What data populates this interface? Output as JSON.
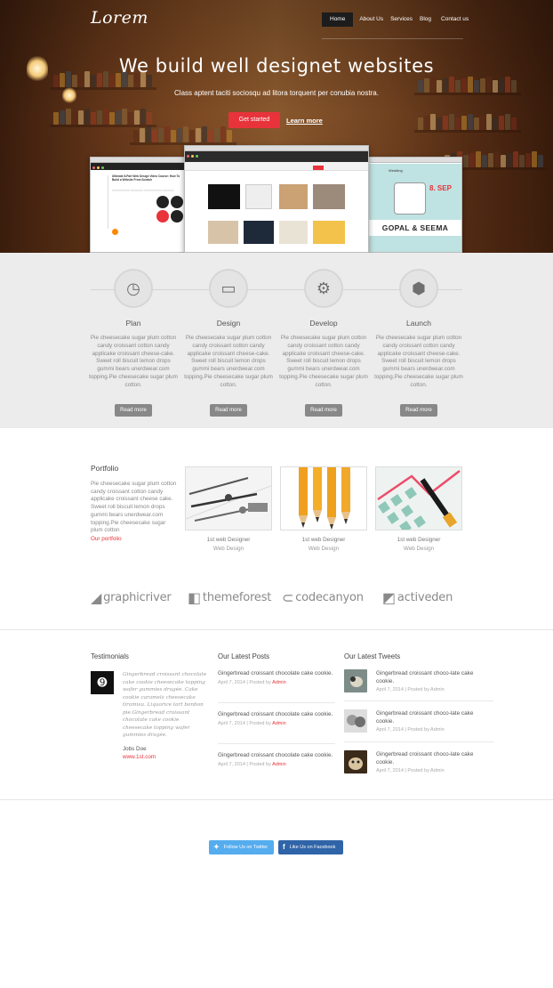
{
  "header": {
    "logo": "Lorem",
    "nav": [
      "Home",
      "About Us",
      "Services",
      "Blog",
      "Contact us"
    ]
  },
  "hero": {
    "title": "We build well designet websites",
    "subtitle": "Class aptent taciti sociosqu ad litora torquent per conubia nostra.",
    "cta_label": "Get started",
    "learn_label": "Learn more",
    "shot_left_heading": "Ultimate 8-Part Web Design Video Course: How To Build a Website From Scratch",
    "shot_right_names": "GOPAL & SEEMA",
    "shot_right_date": "8. SEP",
    "shot_right_wedding": "Wedding"
  },
  "process": {
    "read_more": "Read more",
    "steps": [
      {
        "icon": "clock-icon",
        "glyph": "◷",
        "title": "Plan",
        "text": "Pie cheesecake sugar plum cotton candy croissant cotton candy applicake croissant cheese-cake. Sweet roll biscuit lemon drops gummi bears unerdwear.com topping.Pie cheesecake sugar plum cotton."
      },
      {
        "icon": "laptop-icon",
        "glyph": "▭",
        "title": "Design",
        "text": "Pie cheesecake sugar plum cotton candy croissant cotton candy applicake croissant cheese-cake. Sweet roll biscuit lemon drops gummi bears unerdwear.com topping.Pie cheesecake sugar plum cotton."
      },
      {
        "icon": "gear-icon",
        "glyph": "⚙",
        "title": "Develop",
        "text": "Pie cheesecake sugar plum cotton candy croissant cotton candy applicake croissant cheese-cake. Sweet roll biscuit lemon drops gummi bears unerdwear.com topping.Pie cheesecake sugar plum cotton."
      },
      {
        "icon": "cube-icon",
        "glyph": "⬢",
        "title": "Launch",
        "text": "Pie cheesecake sugar plum cotton candy croissant cotton candy applicake croissant cheese-cake. Sweet roll biscuit lemon drops gummi bears unerdwear.com topping.Pie cheesecake sugar plum cotton."
      }
    ]
  },
  "portfolio": {
    "title": "Portfolio",
    "text": "Pie cheesecake sugar plum cotton candy croissant cotton candy applicake croissant cheese cake. Sweet roll biscuit lemon drops gummi bears unerdwear.com topping.Pie cheesecake sugar plum cotton",
    "link": "Our portfolio",
    "items": [
      {
        "caption": "1st web Designer",
        "sub": "Web Design"
      },
      {
        "caption": "1st web Designer",
        "sub": "Web Design"
      },
      {
        "caption": "1st web Designer",
        "sub": "Web Design"
      }
    ]
  },
  "brands": [
    "graphicriver",
    "themeforest",
    "codecanyon",
    "activeden"
  ],
  "testimonials": {
    "heading": "Testimonials",
    "quote": "Gingerbread croissant chocolate cake cookie cheesecake topping wafer gummies dragée. Cake cookie caramels cheesecake tiramisu. Liquorice tart bonbon pie.Gingerbread croissant chocolate cake cookie cheesecake topping wafer gummies dragée.",
    "name": "Jobs Doe",
    "url": "www.1st.com"
  },
  "posts": {
    "heading": "Our Latest Posts",
    "items": [
      {
        "title": "Gingerbread croissant chocolate cake cookie.",
        "date": "April 7, 2014 | Posted by ",
        "author": "Admin"
      },
      {
        "title": "Gingerbread croissant chocolate cake cookie.",
        "date": "April 7, 2014 | Posted by ",
        "author": "Admin"
      },
      {
        "title": "Gingerbread croissant chocolate cake cookie.",
        "date": "April 7, 2014 | Posted by ",
        "author": "Admin"
      }
    ]
  },
  "tweets": {
    "heading": "Our Latest Tweets",
    "items": [
      {
        "title": "Gingerbread croissant choco-late cake cookie.",
        "meta": "April 7, 2014 | Posted by Admin"
      },
      {
        "title": "Gingerbread croissant choco-late cake cookie.",
        "meta": "April 7, 2014 | Posted by Admin"
      },
      {
        "title": "Gingerbread croissant choco-late cake cookie.",
        "meta": "April 7, 2014 | Posted by Admin"
      }
    ]
  },
  "social": {
    "twitter": "Follow Us on Twitter",
    "facebook": "Like Us on Facebook"
  },
  "colors": {
    "accent": "#e8333b",
    "twitter": "#55acee",
    "facebook": "#3b5998",
    "process_bg": "#ececec"
  }
}
